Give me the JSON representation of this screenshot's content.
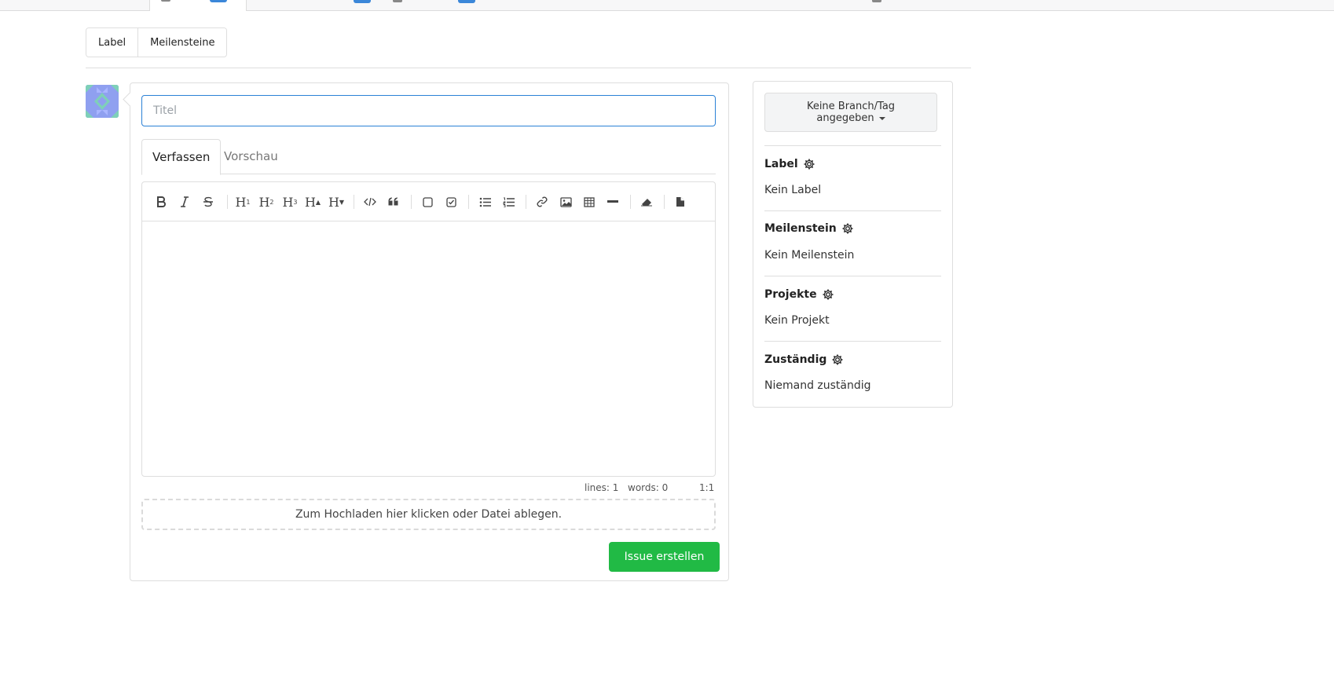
{
  "filters": {
    "label": "Label",
    "milestones": "Meilensteine"
  },
  "issue": {
    "title_placeholder": "Titel",
    "tab_write": "Verfassen",
    "tab_preview": "Vorschau",
    "stats": {
      "lines": "lines: 1",
      "words": "words: 0",
      "cursor": "1:1"
    },
    "dropzone": "Zum Hochladen hier klicken oder Datei ablegen.",
    "submit": "Issue erstellen"
  },
  "toolbar_icons": [
    "bold-icon",
    "italic-icon",
    "strikethrough-icon",
    "heading-1-icon",
    "heading-2-icon",
    "heading-3-icon",
    "heading-bigger-icon",
    "heading-smaller-icon",
    "code-icon",
    "quote-icon",
    "unchecked-box-icon",
    "checked-box-icon",
    "unordered-list-icon",
    "ordered-list-icon",
    "link-icon",
    "image-icon",
    "table-icon",
    "horizontal-rule-icon",
    "eraser-icon",
    "file-icon"
  ],
  "sidebar": {
    "branch_line1": "Keine Branch/Tag",
    "branch_line2": "angegeben",
    "labels_title": "Label",
    "labels_value": "Kein Label",
    "milestone_title": "Meilenstein",
    "milestone_value": "Kein Meilenstein",
    "projects_title": "Projekte",
    "projects_value": "Kein Projekt",
    "assignees_title": "Zuständig",
    "assignees_value": "Niemand zuständig"
  },
  "colors": {
    "accent": "#2b81d6",
    "submit": "#21ba45",
    "avatar": "#8fa0f0"
  }
}
